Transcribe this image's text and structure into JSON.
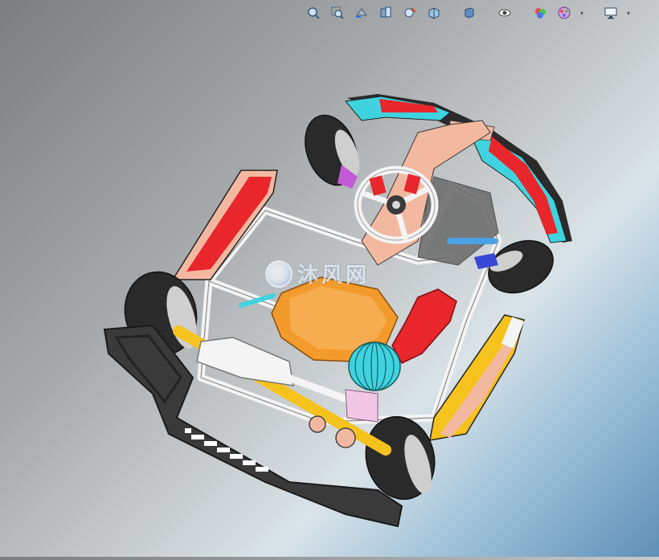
{
  "toolbar": {
    "buttons": [
      {
        "name": "zoom-to-fit-icon"
      },
      {
        "name": "zoom-to-area-icon"
      },
      {
        "name": "previous-view-icon"
      },
      {
        "name": "section-view-icon"
      },
      {
        "name": "dynamic-annotation-icon"
      },
      {
        "name": "view-orientation-icon"
      },
      {
        "name": "display-style-icon"
      },
      {
        "name": "hide-show-items-icon"
      },
      {
        "name": "edit-appearance-icon"
      },
      {
        "name": "apply-scene-icon"
      },
      {
        "name": "view-settings-icon"
      }
    ]
  },
  "watermark": {
    "text": "沐风网"
  },
  "colors": {
    "frame": "#f4f4f4",
    "bodywork_red": "#e8262b",
    "bodywork_cyan": "#3fd3df",
    "seat_orange": "#f39a2c",
    "axle_yellow": "#f6c21d",
    "side_pod_peach": "#f2b9a0",
    "tire": "#2a2a2a",
    "bumper": "#3a3a3a"
  }
}
